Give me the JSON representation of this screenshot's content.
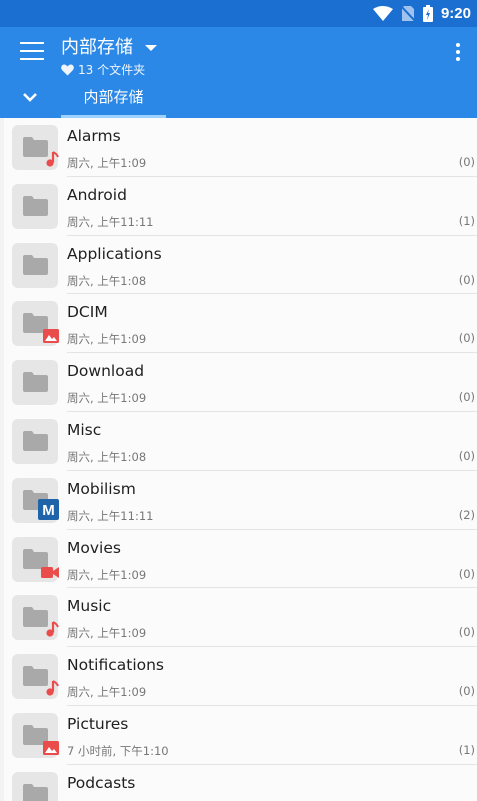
{
  "status": {
    "time": "9:20"
  },
  "header": {
    "title": "内部存储",
    "subtitle": "13 个文件夹",
    "tab_label": "内部存储",
    "accent": "#2b88e6",
    "statusbar_color": "#1a6fd0"
  },
  "files": [
    {
      "name": "Alarms",
      "date": "周六, 上午1:09",
      "count": "(0)",
      "badge": "music-note-icon"
    },
    {
      "name": "Android",
      "date": "周六, 上午11:11",
      "count": "(1)",
      "badge": ""
    },
    {
      "name": "Applications",
      "date": "周六, 上午1:08",
      "count": "(0)",
      "badge": ""
    },
    {
      "name": "DCIM",
      "date": "周六, 上午1:09",
      "count": "(0)",
      "badge": "image-icon"
    },
    {
      "name": "Download",
      "date": "周六, 上午1:09",
      "count": "(0)",
      "badge": ""
    },
    {
      "name": "Misc",
      "date": "周六, 上午1:08",
      "count": "(0)",
      "badge": ""
    },
    {
      "name": "Mobilism",
      "date": "周六, 上午11:11",
      "count": "(2)",
      "badge": "mobilism-logo-icon"
    },
    {
      "name": "Movies",
      "date": "周六, 上午1:09",
      "count": "(0)",
      "badge": "video-camera-icon"
    },
    {
      "name": "Music",
      "date": "周六, 上午1:09",
      "count": "(0)",
      "badge": "music-note-icon"
    },
    {
      "name": "Notifications",
      "date": "周六, 上午1:09",
      "count": "(0)",
      "badge": "music-note-icon"
    },
    {
      "name": "Pictures",
      "date": "7 小时前, 下午1:10",
      "count": "(1)",
      "badge": "image-icon"
    },
    {
      "name": "Podcasts",
      "date": "",
      "count": "",
      "badge": ""
    }
  ]
}
